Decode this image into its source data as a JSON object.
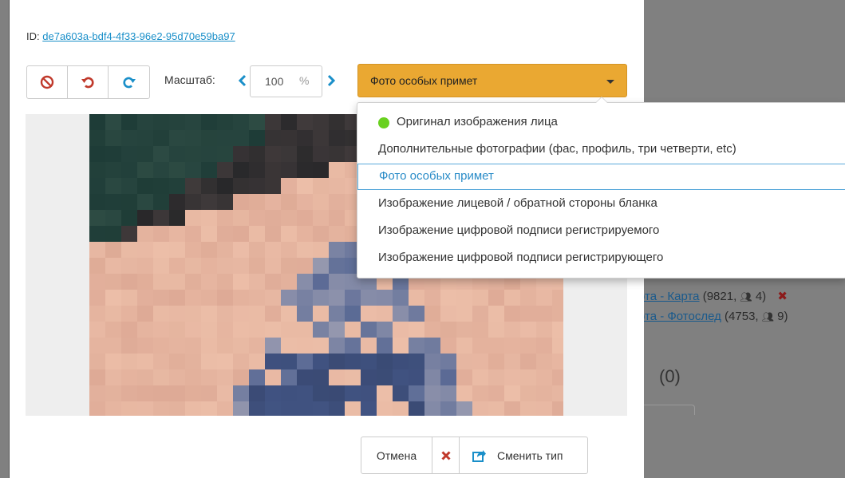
{
  "background": {
    "row1_link": "рта - Карта",
    "row1_count": "(9821,",
    "row1_people": "4)",
    "row2_link": "рта - Фотослед",
    "row2_count": "(4753,",
    "row2_people": "9)",
    "counter": "(0)"
  },
  "modal": {
    "id_prefix": "ID:",
    "id_value": "de7a603a-bdf4-4f33-96e2-95d70e59ba97",
    "toolbar": {
      "block_icon": "ban-icon",
      "undo_icon": "undo-icon",
      "redo_icon": "redo-icon"
    },
    "scale_label": "Масштаб:",
    "scale_value": "100",
    "scale_unit": "%",
    "type_select": {
      "selected": "Фото особых примет",
      "options": [
        {
          "label": "Оригинал изображения лица",
          "status_color": "#69d11f"
        },
        {
          "label": "Дополнительные фотографии (фас, профиль, три четверти, etc)"
        },
        {
          "label": "Фото особых примет",
          "selected": true
        },
        {
          "label": "Изображение лицевой / обратной стороны бланка"
        },
        {
          "label": "Изображение цифровой подписи регистрируемого"
        },
        {
          "label": "Изображение цифровой подписи регистрирующего"
        }
      ]
    },
    "footer": {
      "cancel_label": "Отмена",
      "change_label": "Сменить тип"
    }
  },
  "colors": {
    "accent_select": "#eaa832",
    "link": "#1a8fc9",
    "icon_red": "#c0392b",
    "icon_blue": "#1a8fc9",
    "status_green": "#69d11f"
  }
}
